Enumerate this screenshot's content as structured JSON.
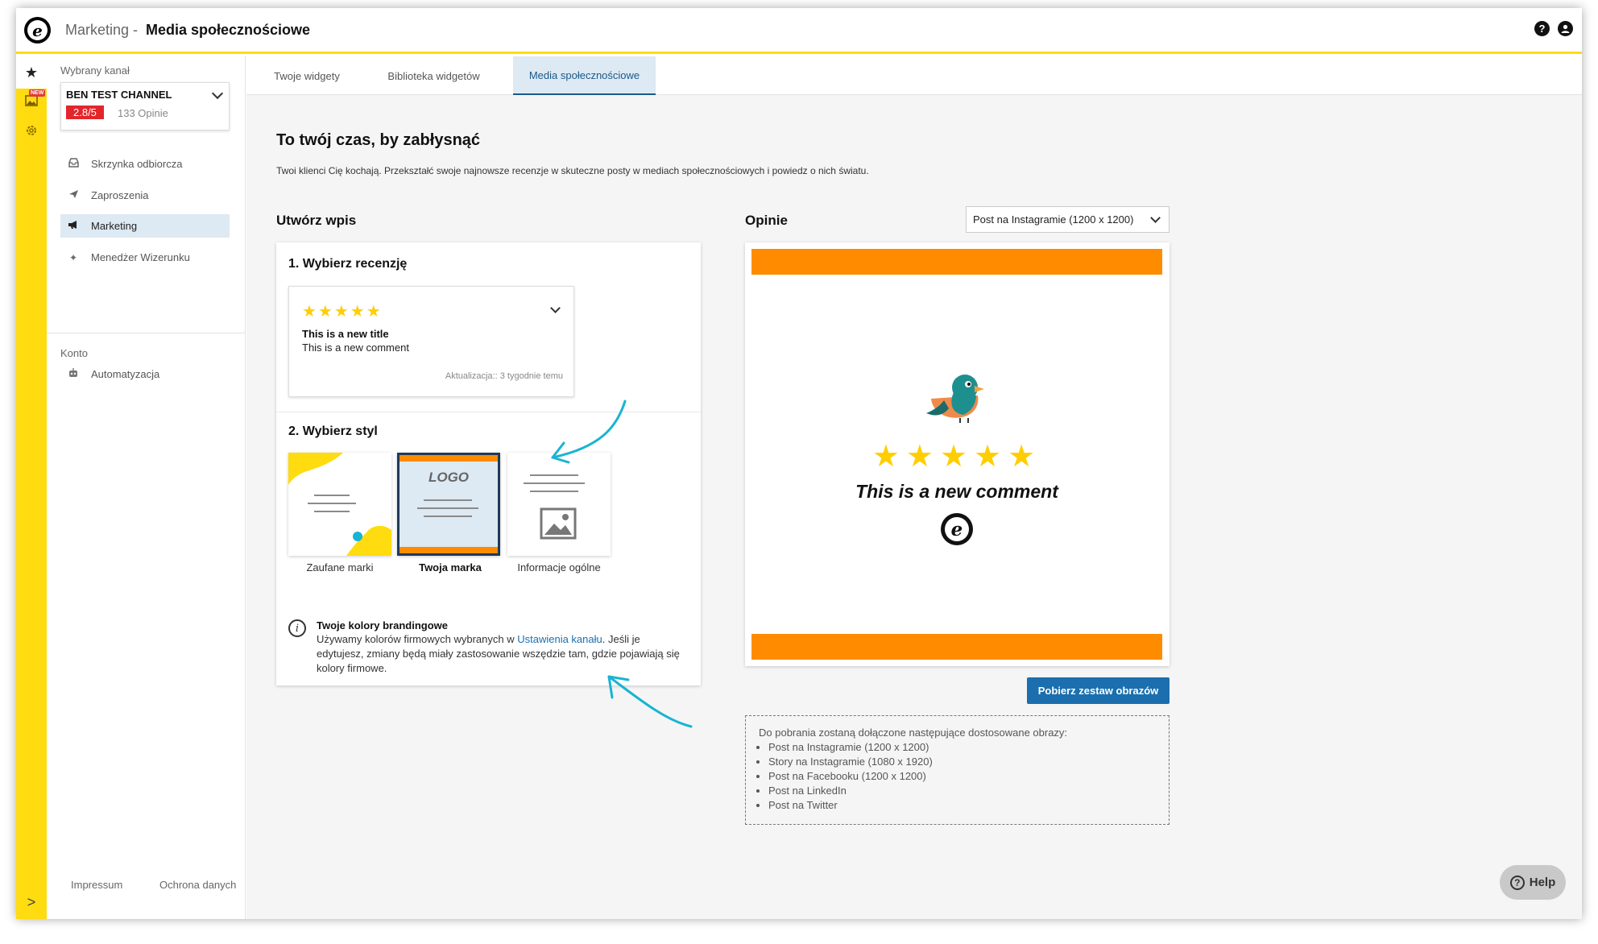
{
  "header": {
    "logo_letter": "e",
    "breadcrumb_root": "Marketing",
    "breadcrumb_sep": "-",
    "breadcrumb_current": "Media społecznościowe",
    "help_icon": "?",
    "account_icon": "user-icon"
  },
  "rail": {
    "active_icon": "★",
    "new_badge": "NEW",
    "expand_icon": ">"
  },
  "sidebar": {
    "channel_label": "Wybrany kanał",
    "channel_name": "BEN TEST CHANNEL",
    "channel_score": "2.8/5",
    "channel_reviews": "133 Opinie",
    "nav": [
      {
        "label": "Skrzynka odbiorcza",
        "icon": "inbox-icon"
      },
      {
        "label": "Zaproszenia",
        "icon": "send-icon"
      },
      {
        "label": "Marketing",
        "icon": "megaphone-icon"
      },
      {
        "label": "Menedżer Wizerunku",
        "icon": "sparkle-icon"
      }
    ],
    "account_label": "Konto",
    "account_nav": [
      {
        "label": "Automatyzacja",
        "icon": "robot-icon"
      }
    ],
    "footer": {
      "impressum": "Impressum",
      "privacy": "Ochrona danych"
    }
  },
  "tabs": [
    {
      "label": "Twoje widgety"
    },
    {
      "label": "Biblioteka widgetów"
    },
    {
      "label": "Media społecznościowe"
    }
  ],
  "main": {
    "title": "To twój czas, by zabłysnąć",
    "subtitle": "Twoi klienci Cię kochają. Przekształć swoje najnowsze recenzje w skuteczne posty w mediach społecznościowych i powiedz o nich światu.",
    "create_heading": "Utwórz wpis",
    "step1": "1. Wybierz recenzję",
    "review": {
      "stars": "★★★★★",
      "title": "This is a new title",
      "comment": "This is a new comment",
      "updated": "Aktualizacja:: 3 tygodnie temu"
    },
    "step2": "2. Wybierz styl",
    "styles": [
      {
        "label": "Zaufane marki"
      },
      {
        "label": "Twoja marka",
        "logo_text": "LOGO"
      },
      {
        "label": "Informacje ogólne"
      }
    ],
    "branding": {
      "title": "Twoje kolory brandingowe",
      "text_before": "Używamy kolorów firmowych wybranych w ",
      "link": "Ustawienia kanału",
      "text_after": ". Jeśli je edytujesz, zmiany będą miały zastosowanie wszędzie tam, gdzie pojawiają się kolory firmowe."
    },
    "preview_heading": "Opinie",
    "format_select": "Post na Instagramie (1200 x 1200)",
    "preview": {
      "stars": "★★★★★",
      "comment": "This is a new comment",
      "logo_letter": "e"
    },
    "download_button": "Pobierz zestaw obrazów",
    "download_info": {
      "intro": "Do pobrania zostaną dołączone następujące dostosowane obrazy:",
      "items": [
        "Post na Instagramie (1200 x 1200)",
        "Story na Instagramie (1080 x 1920)",
        "Post na Facebooku (1200 x 1200)",
        "Post na LinkedIn",
        "Post na Twitter"
      ]
    },
    "help_button": "Help"
  },
  "colors": {
    "brand_yellow": "#ffdc0f",
    "accent_blue": "#1b6fae",
    "score_red": "#e2262b",
    "post_orange": "#ff8c00",
    "annotation_cyan": "#18b4d2"
  }
}
